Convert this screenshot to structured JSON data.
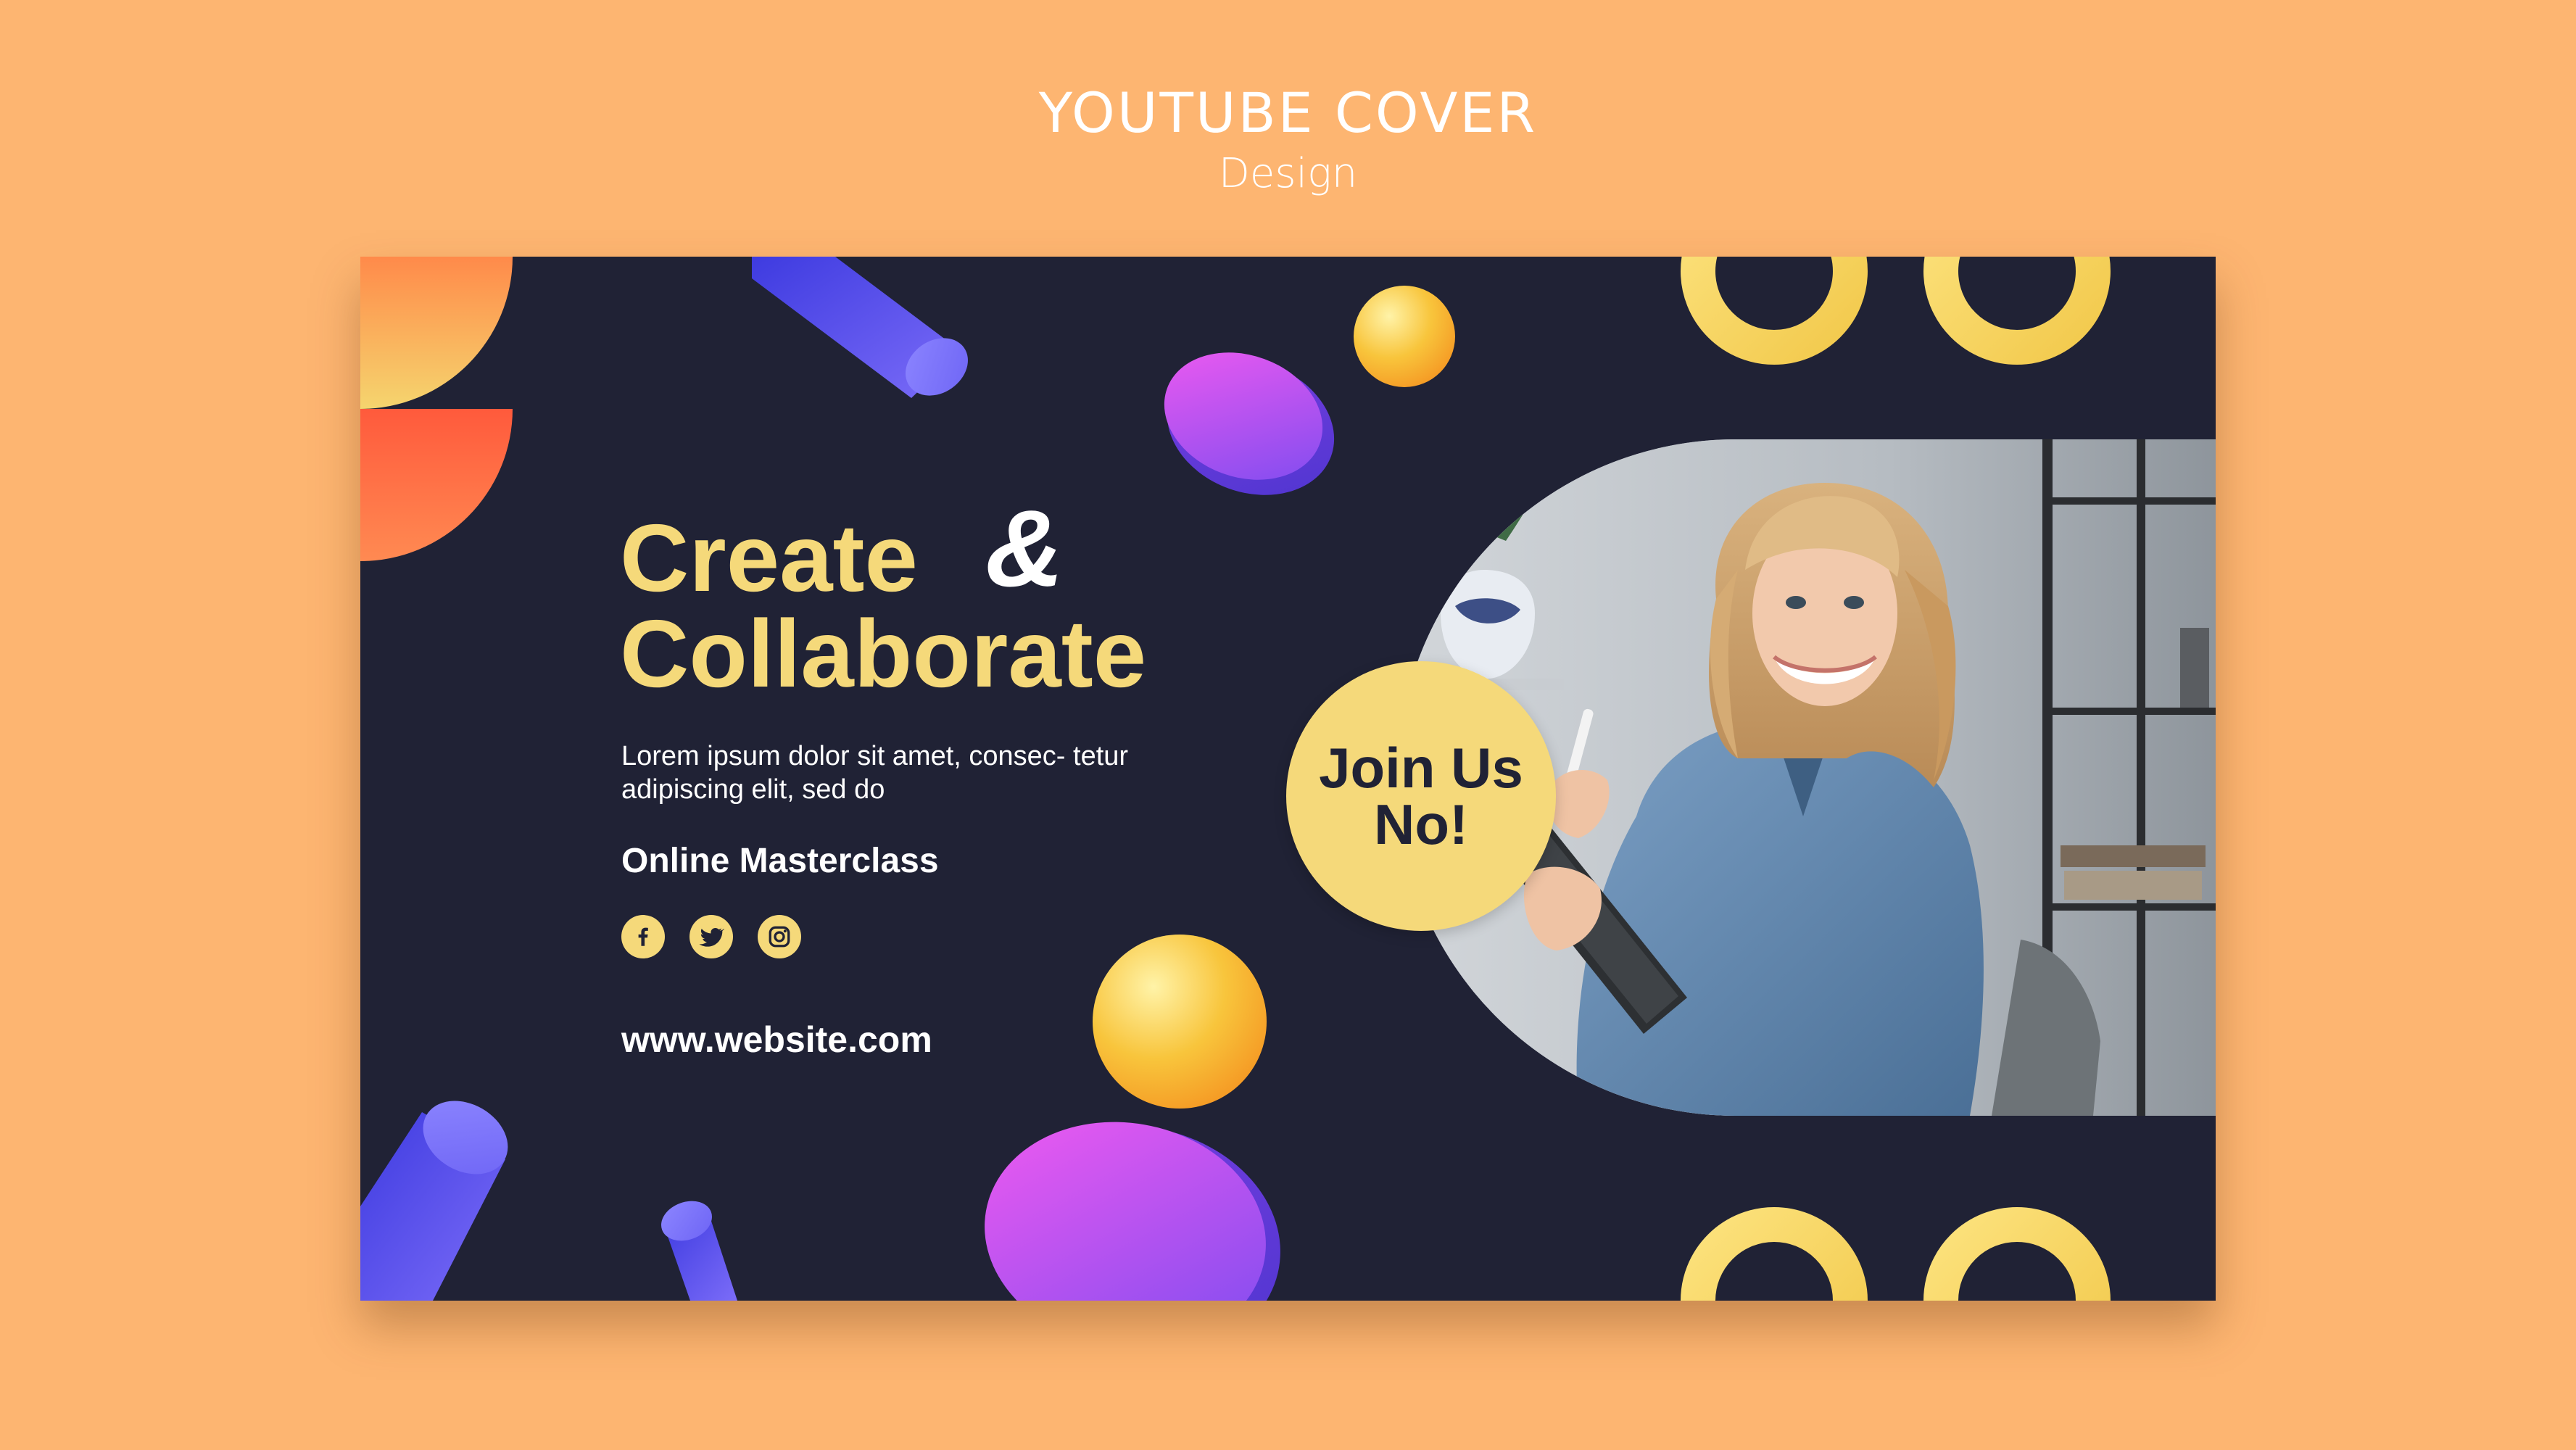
{
  "header": {
    "title": "YOUTUBE COVER",
    "subtitle": "Design"
  },
  "cover": {
    "headline_line1": "Create",
    "headline_line2": "Collaborate",
    "ampersand": "&",
    "description": "Lorem ipsum dolor sit amet, consec- tetur adipiscing elit, sed do",
    "masterclass": "Online Masterclass",
    "website": "www.website.com",
    "join_badge": "Join Us\nNo!",
    "social_icons": [
      "facebook-icon",
      "twitter-icon",
      "instagram-icon"
    ]
  },
  "colors": {
    "page_background": "#FDB571",
    "cover_background": "#202235",
    "accent_yellow": "#F5D97A",
    "text_white": "#FFFFFF",
    "shape_orange": "#FF6A45",
    "shape_purple": "#A54CF0",
    "shape_blue": "#5A52F5"
  }
}
